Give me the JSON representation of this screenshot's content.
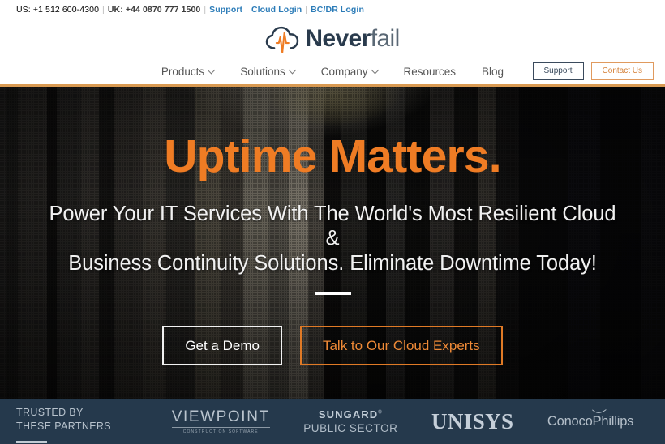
{
  "topbar": {
    "phone_us": "US: +1 512 600-4300",
    "phone_uk": "UK: +44 0870 777 1500",
    "separator": "|",
    "links": [
      {
        "label": "Support"
      },
      {
        "label": "Cloud Login"
      },
      {
        "label": "BC/DR Login"
      }
    ]
  },
  "brand": {
    "name_bold": "Never",
    "name_light": "fail",
    "logo_icon": "cloud-pulse-icon",
    "cloud_color": "#2a3b4d",
    "pulse_color": "#ef7c24"
  },
  "nav": {
    "items": [
      {
        "label": "Products",
        "has_dropdown": true
      },
      {
        "label": "Solutions",
        "has_dropdown": true
      },
      {
        "label": "Company",
        "has_dropdown": true
      },
      {
        "label": "Resources",
        "has_dropdown": false
      },
      {
        "label": "Blog",
        "has_dropdown": false
      }
    ],
    "buttons": {
      "support": "Support",
      "contact": "Contact Us"
    },
    "underline_color": "#d99a52"
  },
  "hero": {
    "title": "Uptime Matters.",
    "subtitle_line1": "Power Your IT Services With The World's Most Resilient Cloud &",
    "subtitle_line2": "Business Continuity Solutions. Eliminate Downtime Today!",
    "cta_primary": "Get a Demo",
    "cta_secondary": "Talk to Our Cloud Experts",
    "title_color": "#ef7c24",
    "background": "blurred-data-center-server-racks"
  },
  "partners": {
    "heading_line1": "TRUSTED BY",
    "heading_line2": "THESE PARTNERS",
    "background_color": "#25394c",
    "logos": [
      {
        "id": "viewpoint",
        "line1": "VIEWPOINT",
        "line2": "CONSTRUCTION SOFTWARE"
      },
      {
        "id": "sungard",
        "line1": "SUNGARD",
        "line2": "PUBLIC SECTOR"
      },
      {
        "id": "unisys",
        "line1": "UNISYS",
        "line2": ""
      },
      {
        "id": "conocophillips",
        "line1": "ConocoPhillips",
        "line2": ""
      }
    ]
  }
}
